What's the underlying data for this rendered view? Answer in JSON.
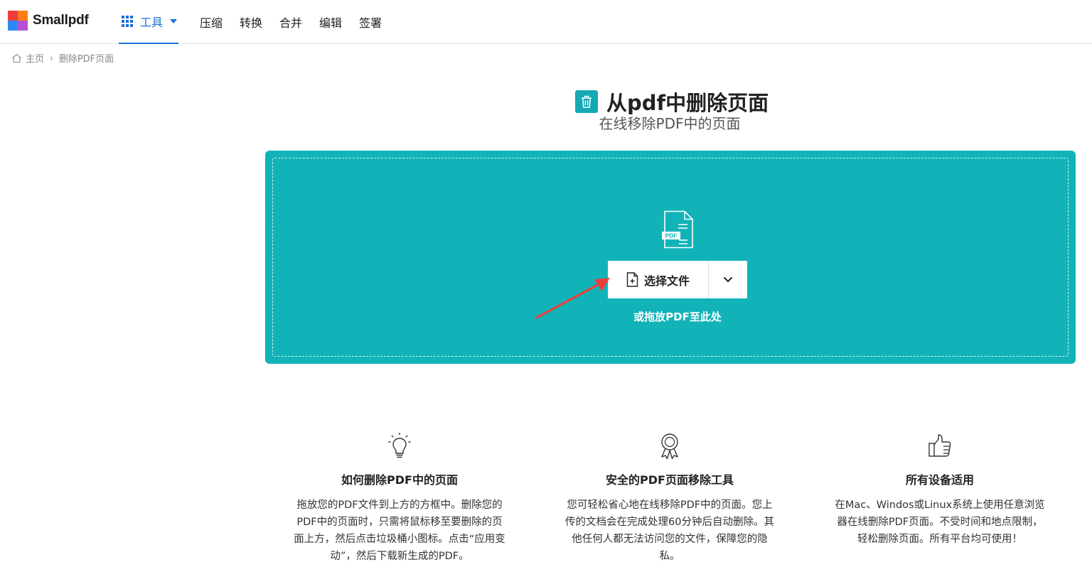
{
  "brand": {
    "name": "Smallpdf",
    "logo_colors": [
      "#f03e3e",
      "#fd7e14",
      "#2b8af7",
      "#8e44ad"
    ]
  },
  "nav": {
    "tools_label": "工具",
    "items": [
      "压缩",
      "转换",
      "合并",
      "编辑",
      "签署"
    ]
  },
  "breadcrumb": {
    "home": "主页",
    "separator": "›",
    "current": "删除PDF页面"
  },
  "hero": {
    "title": "从pdf中删除页面",
    "subtitle": "在线移除PDF中的页面"
  },
  "upload": {
    "pdf_badge": "PDF",
    "choose_file_label": "选择文件",
    "drop_hint": "或拖放PDF至此处"
  },
  "features": [
    {
      "icon": "lightbulb-icon",
      "title": "如何删除PDF中的页面",
      "text": "拖放您的PDF文件到上方的方框中。删除您的PDF中的页面时，只需将鼠标移至要删除的页面上方，然后点击垃圾桶小图标。点击“应用变动”，然后下载新生成的PDF。"
    },
    {
      "icon": "award-ribbon-icon",
      "title": "安全的PDF页面移除工具",
      "text": "您可轻松省心地在线移除PDF中的页面。您上传的文档会在完成处理60分钟后自动删除。其他任何人都无法访问您的文件，保障您的隐私。"
    },
    {
      "icon": "thumbs-up-icon",
      "title": "所有设备适用",
      "text": "在Mac、Windos或Linux系统上使用任意浏览器在线删除PDF页面。不受时间和地点限制，轻松删除页面。所有平台均可使用！"
    }
  ],
  "colors": {
    "accent": "#1a6fd8",
    "dropzone": "#12b3b8",
    "annotation_arrow": "#e8413c"
  }
}
